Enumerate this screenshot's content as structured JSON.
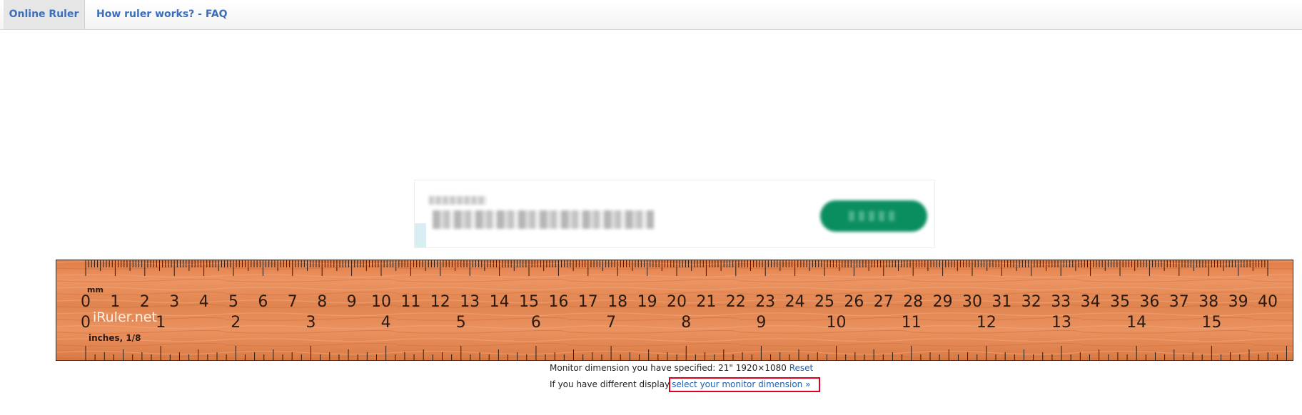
{
  "nav": {
    "tabs": [
      {
        "label": "Online Ruler"
      },
      {
        "label": "How ruler works? - FAQ"
      }
    ]
  },
  "ruler": {
    "brand": "iRuler.net",
    "unit_top": "mm",
    "unit_bottom": "inches, 1/8",
    "cm_labels": [
      "0",
      "1",
      "2",
      "3",
      "4",
      "5",
      "6",
      "7",
      "8",
      "9",
      "10",
      "11",
      "12",
      "13",
      "14",
      "15",
      "16",
      "17",
      "18",
      "19",
      "20",
      "21",
      "22",
      "23",
      "24",
      "25",
      "26",
      "27",
      "28",
      "29",
      "30",
      "31",
      "32",
      "33",
      "34",
      "35",
      "36",
      "37",
      "38",
      "39",
      "40"
    ],
    "inch_labels": [
      "0",
      "1",
      "2",
      "3",
      "4",
      "5",
      "6",
      "7",
      "8",
      "9",
      "10",
      "11",
      "12",
      "13",
      "14",
      "15"
    ],
    "colors": {
      "wood": "#e58a55",
      "wood_dark": "#c8693a",
      "ticks": "#2b1a12",
      "brand": "#ffe9dd"
    }
  },
  "info": {
    "line1_text": "Monitor dimension you have specified: 21\" 1920×1080",
    "reset_label": "Reset",
    "line2_text": "If you have different display",
    "select_label": "select your monitor dimension »"
  }
}
